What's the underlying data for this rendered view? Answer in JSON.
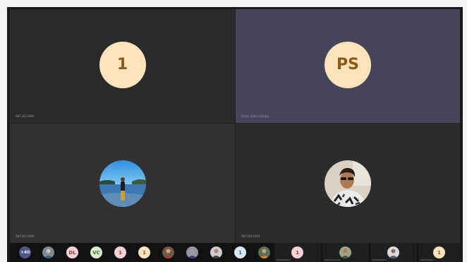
{
  "tiles": [
    {
      "initials": "1",
      "label": "0871011989"
    },
    {
      "initials": "PS",
      "label": "Pooja Sahu Chhipa"
    },
    {
      "photo_icon": "beach-person-photo",
      "label": "0871011990"
    },
    {
      "photo_icon": "man-sunglasses-photo",
      "label": "0871011993"
    }
  ],
  "bar": {
    "overflow_count": "+40",
    "participants": [
      {
        "type": "photo",
        "icon": "person-photo"
      },
      {
        "type": "initials",
        "text": "DL",
        "color": "#f6d2d6"
      },
      {
        "type": "initials",
        "text": "VC",
        "color": "#dceccf"
      },
      {
        "type": "initials",
        "text": "1",
        "color": "#f6d2d6"
      },
      {
        "type": "initials",
        "text": "1",
        "color": "#fbe4bc"
      },
      {
        "type": "photo",
        "icon": "person-photo"
      },
      {
        "type": "photo",
        "icon": "person-photo"
      },
      {
        "type": "photo",
        "icon": "person-photo"
      },
      {
        "type": "initials",
        "text": "1",
        "color": "#d8e6f6"
      },
      {
        "type": "photo",
        "icon": "person-photo"
      }
    ],
    "tiles": [
      {
        "type": "initials",
        "text": "1",
        "name": "0878000001"
      },
      {
        "type": "photo",
        "icon": "person-photo",
        "name": "Santosh Kumar"
      },
      {
        "type": "photo",
        "icon": "person-photo",
        "name": "0878000004"
      },
      {
        "type": "initials",
        "text": "1",
        "name": "0878000003"
      }
    ]
  }
}
